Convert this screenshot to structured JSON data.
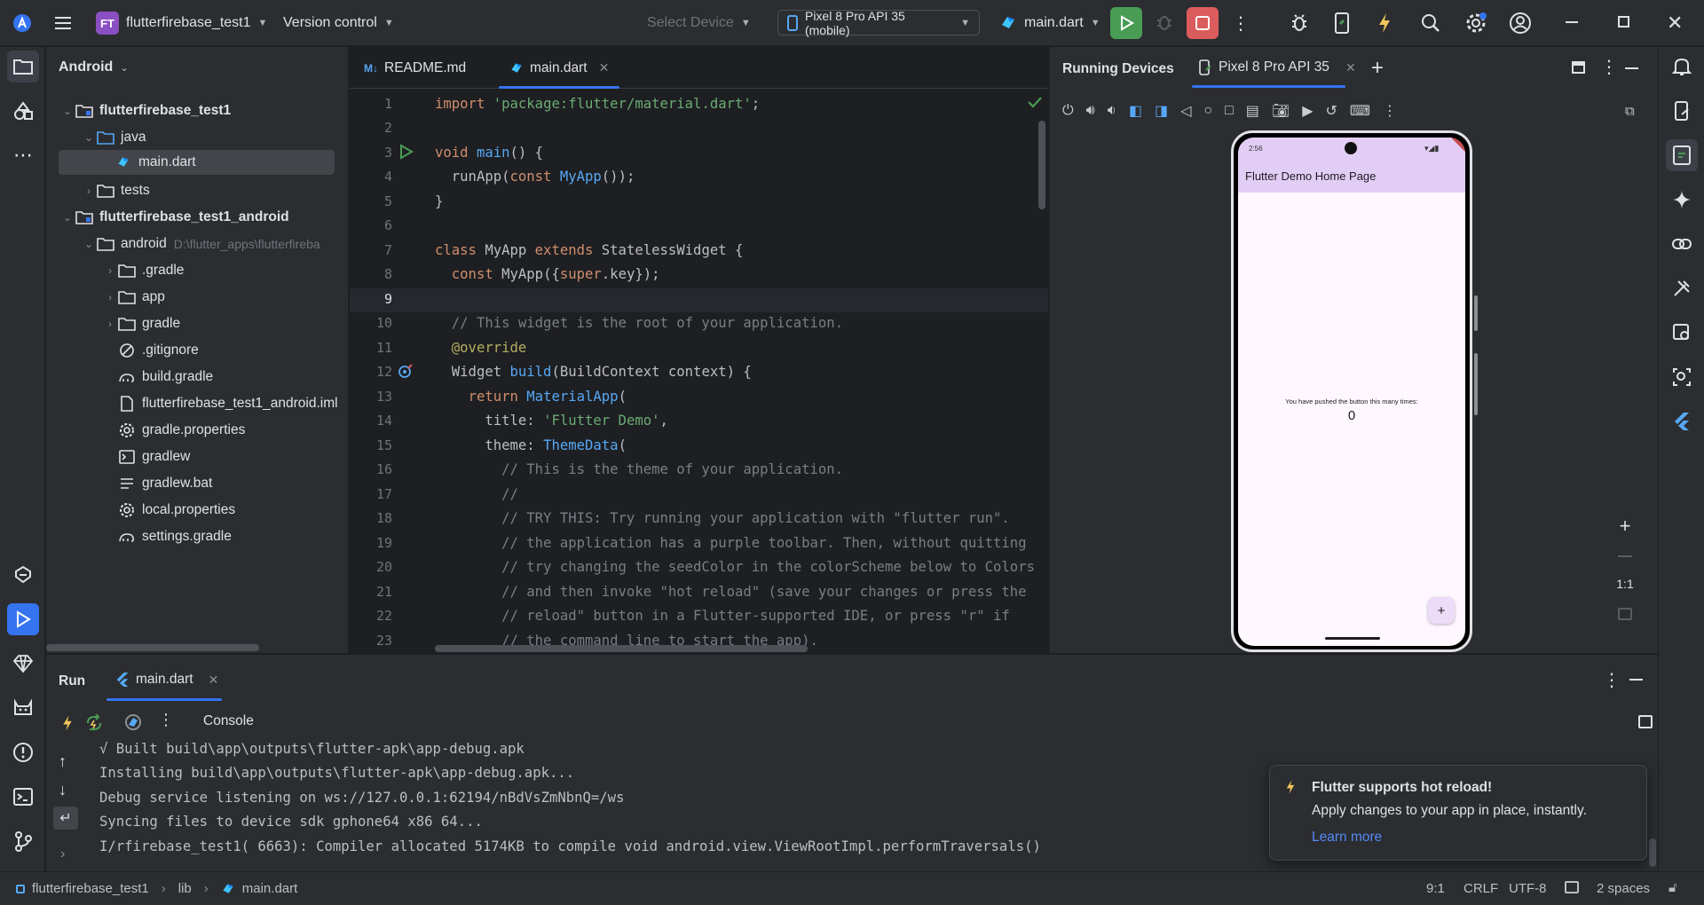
{
  "titlebar": {
    "project_badge": "FT",
    "project_name": "flutterfirebase_test1",
    "vcs_label": "Version control",
    "select_device": "Select Device",
    "device_selector": "Pixel 8 Pro API 35 (mobile)",
    "run_config": "main.dart"
  },
  "project_panel": {
    "view_label": "Android",
    "items": [
      {
        "label": "flutterfirebase_test1",
        "bold": true
      },
      {
        "label": "java"
      },
      {
        "label": "main.dart"
      },
      {
        "label": "tests"
      },
      {
        "label": "flutterfirebase_test1_android",
        "bold": true
      },
      {
        "label": "android",
        "path": "D:\\flutter_apps\\flutterfireba"
      },
      {
        "label": ".gradle"
      },
      {
        "label": "app"
      },
      {
        "label": "gradle"
      },
      {
        "label": ".gitignore"
      },
      {
        "label": "build.gradle"
      },
      {
        "label": "flutterfirebase_test1_android.iml"
      },
      {
        "label": "gradle.properties"
      },
      {
        "label": "gradlew"
      },
      {
        "label": "gradlew.bat"
      },
      {
        "label": "local.properties"
      },
      {
        "label": "settings.gradle"
      }
    ]
  },
  "editor": {
    "tabs": [
      {
        "label": "README.md",
        "prefix": "M↓"
      },
      {
        "label": "main.dart"
      }
    ],
    "line_numbers": [
      "1",
      "2",
      "3",
      "4",
      "5",
      "6",
      "7",
      "8",
      "9",
      "10",
      "11",
      "12",
      "13",
      "14",
      "15",
      "16",
      "17",
      "18",
      "19",
      "20",
      "21",
      "22",
      "23"
    ]
  },
  "devices": {
    "title": "Running Devices",
    "tab": "Pixel 8 Pro API 35",
    "app_bar_title": "Flutter Demo Home Page",
    "counter_text": "You have pushed the button this many times:",
    "counter_value": "0",
    "status_time": "2:56",
    "fab_symbol": "+",
    "zoom_ratio": "1:1"
  },
  "run_panel": {
    "title": "Run",
    "tab": "main.dart",
    "console_label": "Console",
    "lines": [
      "√ Built build\\app\\outputs\\flutter-apk\\app-debug.apk",
      "Installing build\\app\\outputs\\flutter-apk\\app-debug.apk...",
      "Debug service listening on ws://127.0.0.1:62194/nBdVsZmNbnQ=/ws",
      "Syncing files to device sdk gphone64 x86 64...",
      "I/rfirebase_test1( 6663): Compiler allocated 5174KB to compile void android.view.ViewRootImpl.performTraversals()"
    ]
  },
  "notification": {
    "title": "Flutter supports hot reload!",
    "body": "Apply changes to your app in place, instantly.",
    "link": "Learn more"
  },
  "statusbar": {
    "crumbs": [
      "flutterfirebase_test1",
      "lib",
      "main.dart"
    ],
    "position": "9:1",
    "line_ending": "CRLF",
    "encoding": "UTF-8",
    "indent": "2 spaces"
  },
  "colors": {
    "accent": "#3574f0",
    "run_green": "#499c54",
    "stop_red": "#db5c5c",
    "badge_purple": "#8a4fc2",
    "phone_appbar": "#e2cdf5"
  }
}
